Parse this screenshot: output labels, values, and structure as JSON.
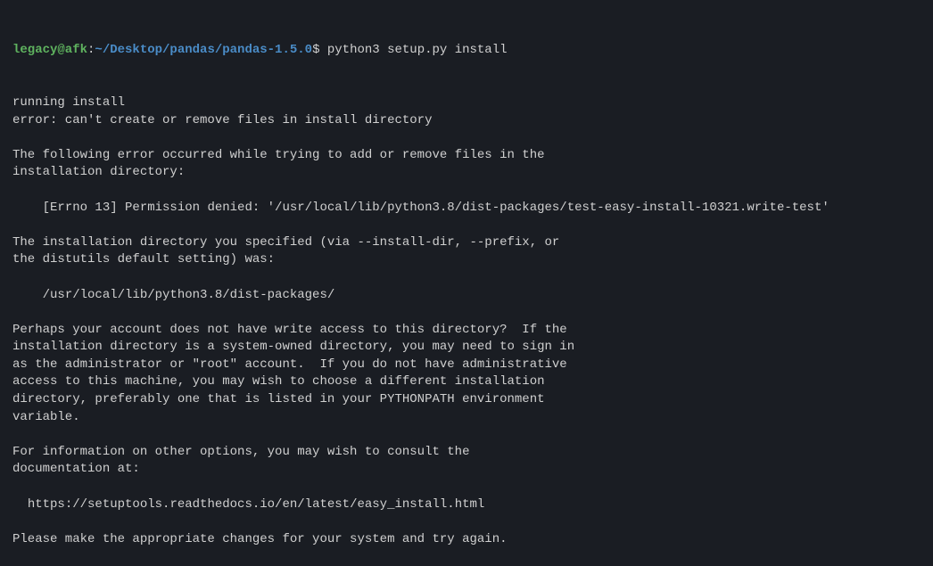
{
  "prompt": {
    "user_host": "legacy@afk",
    "colon1": ":",
    "path": "~/Desktop/pandas/pandas-1.5.0",
    "dollar": "$ ",
    "command": "python3 setup.py install"
  },
  "output": {
    "lines": [
      "running install",
      "error: can't create or remove files in install directory",
      "",
      "The following error occurred while trying to add or remove files in the",
      "installation directory:",
      "",
      "    [Errno 13] Permission denied: '/usr/local/lib/python3.8/dist-packages/test-easy-install-10321.write-test'",
      "",
      "The installation directory you specified (via --install-dir, --prefix, or",
      "the distutils default setting) was:",
      "",
      "    /usr/local/lib/python3.8/dist-packages/",
      "",
      "Perhaps your account does not have write access to this directory?  If the",
      "installation directory is a system-owned directory, you may need to sign in",
      "as the administrator or \"root\" account.  If you do not have administrative",
      "access to this machine, you may wish to choose a different installation",
      "directory, preferably one that is listed in your PYTHONPATH environment",
      "variable.",
      "",
      "For information on other options, you may wish to consult the",
      "documentation at:",
      "",
      "  https://setuptools.readthedocs.io/en/latest/easy_install.html",
      "",
      "Please make the appropriate changes for your system and try again."
    ]
  }
}
